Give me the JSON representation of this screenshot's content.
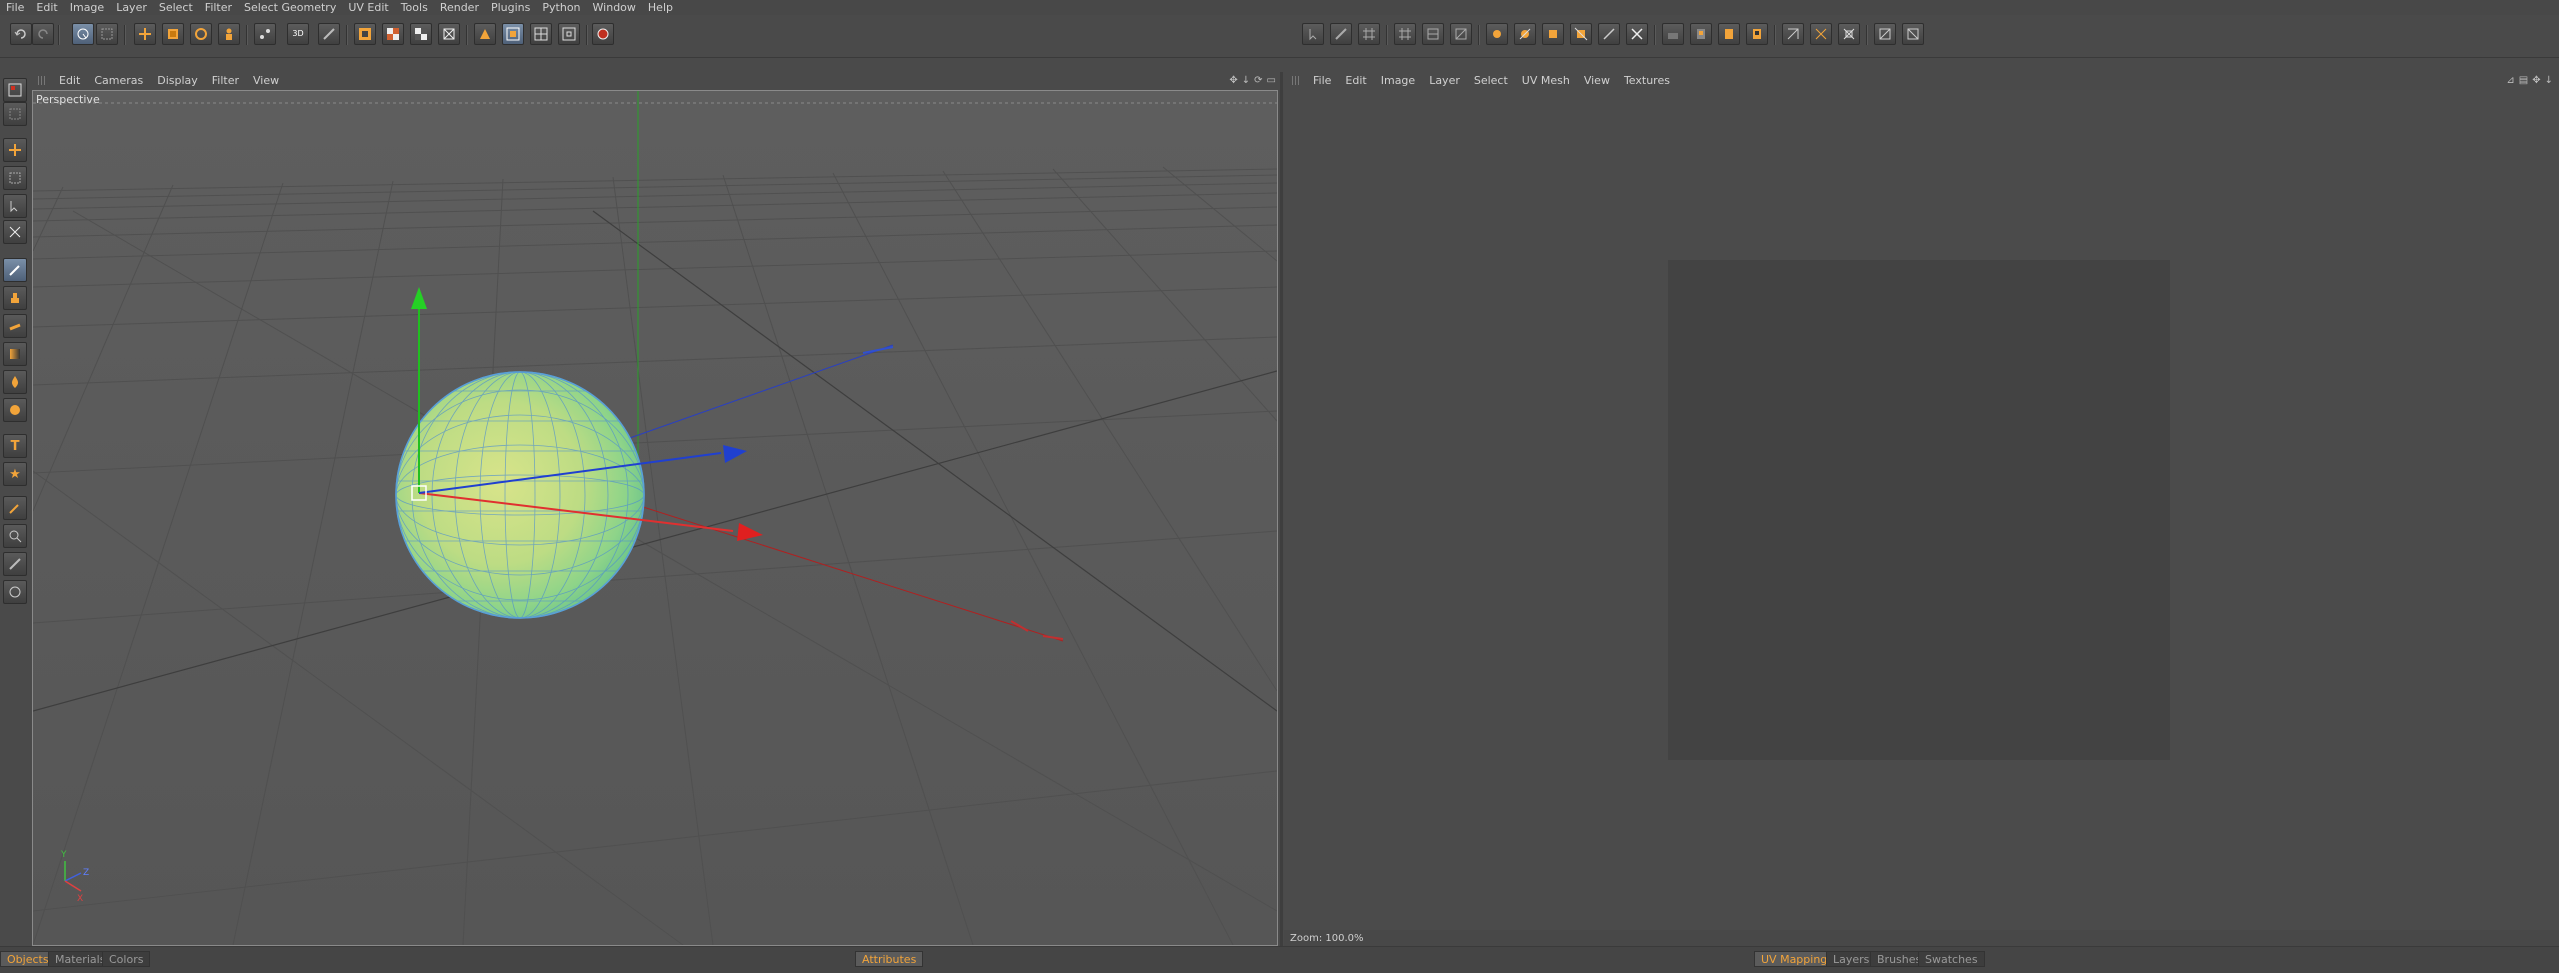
{
  "menubar": {
    "items": [
      "File",
      "Edit",
      "Image",
      "Layer",
      "Select",
      "Filter",
      "Select Geometry",
      "UV Edit",
      "Tools",
      "Render",
      "Plugins",
      "Python",
      "Window",
      "Help"
    ]
  },
  "toolbar": {
    "icons": [
      "undo-icon",
      "redo-icon",
      "live-selection-icon",
      "rect-selection-icon",
      "move-icon",
      "scale-icon",
      "rotate-icon",
      "person-icon",
      "points-icon",
      "3d-paint-icon",
      "brush-icon",
      "layer-add-icon",
      "checker-icon",
      "checker2-icon",
      "checker3-icon",
      "paint-mode-icon",
      "uv-polygon-icon",
      "uv-points-icon",
      "uv-edges-icon",
      "render-icon"
    ],
    "uv_icons": [
      "uv-cursor-icon",
      "uv-brush-icon",
      "uv-grid-icon",
      "uv-grid2-icon",
      "uv-grid3-icon",
      "uv-edit-icon",
      "uv-fill-icon",
      "uv-fill2-icon",
      "uv-fill3-icon",
      "uv-fill4-icon",
      "uv-stroke-icon",
      "uv-cross-icon",
      "uv-mirror-icon",
      "uv-mirror2-icon",
      "uv-layer-icon",
      "uv-layer2-icon",
      "uv-relax-icon",
      "uv-relax2-icon",
      "uv-relax3-icon",
      "uv-pin-icon",
      "uv-pin2-icon"
    ]
  },
  "palette": {
    "icons": [
      "viewport-layout-icon",
      "snap-icon",
      "move-tool-icon",
      "box-icon",
      "select-tool-icon",
      "grid-tool-icon",
      "pen-icon",
      "stamp-icon",
      "smear-icon",
      "gradient-icon",
      "fill-icon",
      "blob-icon",
      "text-icon",
      "star-icon",
      "eyedropper-icon",
      "zoom-icon",
      "ruler-icon",
      "circle-icon"
    ]
  },
  "viewport": {
    "menu": [
      "Edit",
      "Cameras",
      "Display",
      "Filter",
      "View"
    ],
    "label": "Perspective",
    "axis_labels": {
      "y": "Y",
      "z": "Z",
      "x": "X"
    }
  },
  "uv": {
    "menu": [
      "File",
      "Edit",
      "Image",
      "Layer",
      "Select",
      "UV Mesh",
      "View",
      "Textures"
    ],
    "zoom": "Zoom: 100.0%"
  },
  "bottom_tabs": {
    "left": [
      {
        "label": "Objects",
        "active": true
      },
      {
        "label": "Materials",
        "active": false
      },
      {
        "label": "Colors",
        "active": false
      }
    ],
    "center": [
      {
        "label": "Attributes",
        "active": true
      }
    ],
    "right": [
      {
        "label": "UV Mapping",
        "active": true
      },
      {
        "label": "Layers",
        "active": false
      },
      {
        "label": "Brushes",
        "active": false
      },
      {
        "label": "Swatches",
        "active": false
      }
    ]
  },
  "colors": {
    "accent": "#f2a43a",
    "sphere_green": "#8fdc8a",
    "sphere_yellow": "#d8df80",
    "gizmo_x": "#e02020",
    "gizmo_y": "#20c020",
    "gizmo_z": "#2040d0"
  }
}
